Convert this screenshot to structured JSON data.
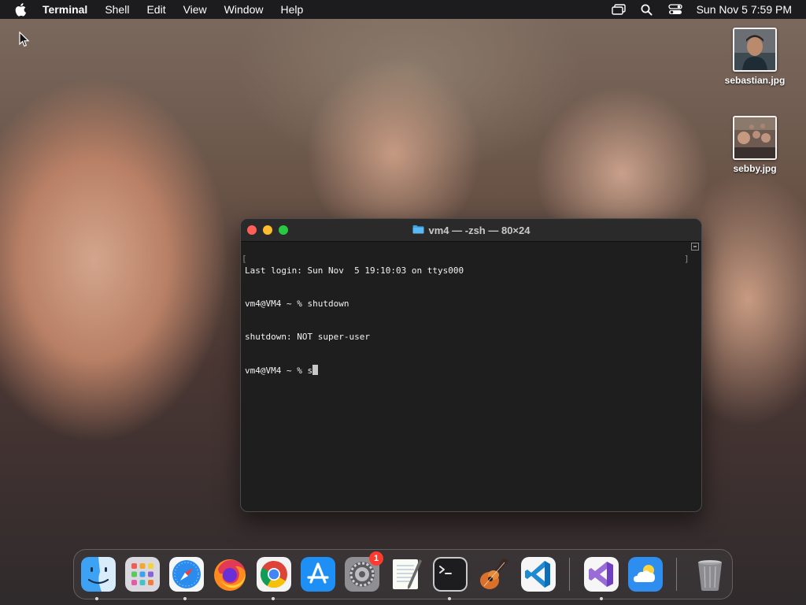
{
  "menubar": {
    "app_name": "Terminal",
    "menus": [
      "Shell",
      "Edit",
      "View",
      "Window",
      "Help"
    ],
    "clock": "Sun Nov 5  7:59 PM"
  },
  "desktop": {
    "files": [
      {
        "name": "sebastian.jpg"
      },
      {
        "name": "sebby.jpg"
      }
    ]
  },
  "terminal": {
    "title": "vm4 — -zsh — 80×24",
    "lines": [
      "Last login: Sun Nov  5 19:10:03 on ttys000",
      "vm4@VM4 ~ % shutdown",
      "shutdown: NOT super-user",
      "vm4@VM4 ~ % s"
    ]
  },
  "dock": {
    "apps": [
      {
        "name": "Finder",
        "icon": "finder-icon",
        "running": true
      },
      {
        "name": "Launchpad",
        "icon": "launchpad-icon",
        "running": false
      },
      {
        "name": "Safari",
        "icon": "safari-icon",
        "running": true
      },
      {
        "name": "Firefox",
        "icon": "firefox-icon",
        "running": false
      },
      {
        "name": "Google Chrome",
        "icon": "chrome-icon",
        "running": true
      },
      {
        "name": "App Store",
        "icon": "app-store-icon",
        "running": false
      },
      {
        "name": "System Settings",
        "icon": "system-settings-icon",
        "running": false,
        "badge": "1"
      },
      {
        "name": "TextEdit",
        "icon": "textedit-icon",
        "running": false
      },
      {
        "name": "Terminal",
        "icon": "terminal-icon",
        "running": true
      },
      {
        "name": "GarageBand",
        "icon": "garageband-icon",
        "running": false
      },
      {
        "name": "Visual Studio Code",
        "icon": "vscode-icon",
        "running": false
      },
      {
        "name": "Visual Studio",
        "icon": "visual-studio-icon",
        "running": true
      },
      {
        "name": "Weather",
        "icon": "weather-icon",
        "running": false
      },
      {
        "name": "Trash",
        "icon": "trash-icon",
        "running": false
      }
    ]
  },
  "colors": {
    "menubar_bg": "#1c1b1e",
    "terminal_bg": "#1e1e1e",
    "close": "#fe5f57",
    "minimize": "#febc2e",
    "zoom": "#28c840",
    "badge": "#ff3b30"
  }
}
